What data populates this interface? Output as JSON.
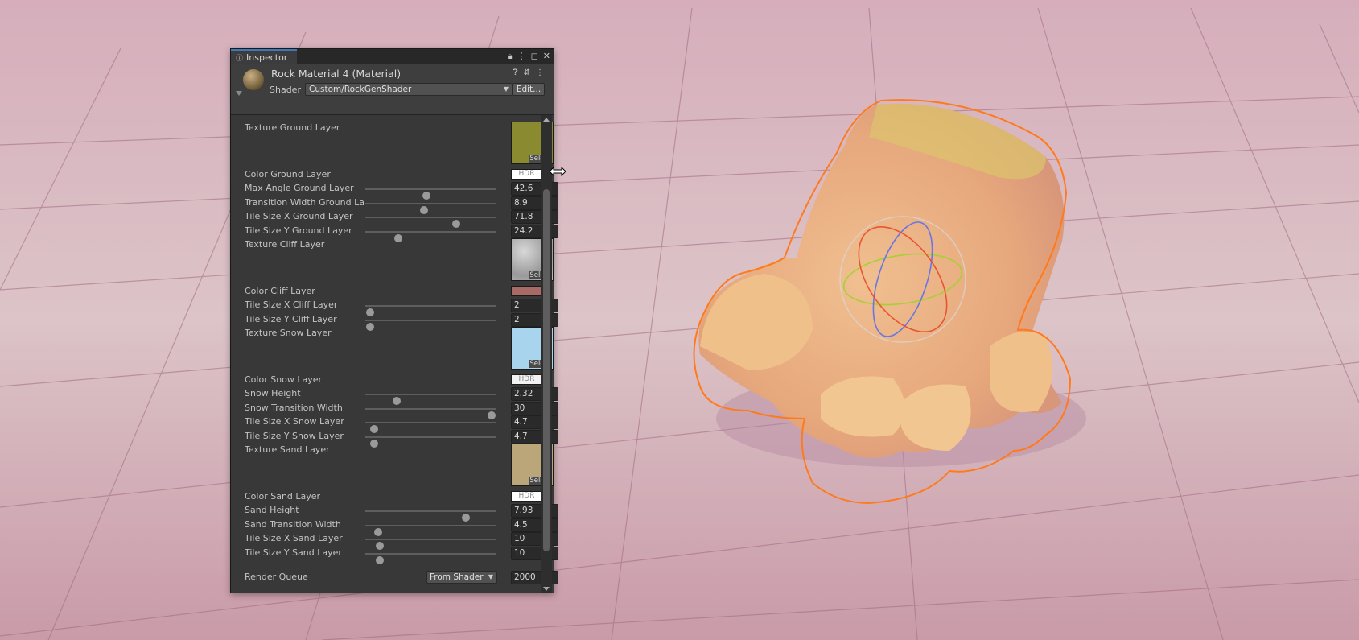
{
  "inspector": {
    "tab_label": "Inspector",
    "tab_icon": "info-icon",
    "window_controls": [
      "lock-icon",
      "kebab-menu-icon",
      "maximize-icon",
      "close-icon"
    ],
    "material_name": "Rock Material 4 (Material)",
    "header_icons": [
      "help-icon",
      "preset-icon",
      "kebab-menu-icon"
    ],
    "shader_label": "Shader",
    "shader_value": "Custom/RockGenShader",
    "edit_label": "Edit...",
    "properties": {
      "texture_ground": {
        "label": "Texture Ground Layer",
        "select": "Select",
        "color": "#8a8a30"
      },
      "color_ground": {
        "label": "Color Ground Layer",
        "swatch_text": "HDR",
        "color": "#ffffff"
      },
      "max_angle_ground": {
        "label": "Max Angle Ground Layer",
        "value": "42.6",
        "fraction": 0.47
      },
      "transition_width_ground": {
        "label": "Transition Width Ground Laye",
        "value": "8.9",
        "fraction": 0.45
      },
      "tile_x_ground": {
        "label": "Tile Size X Ground Layer",
        "value": "71.8",
        "fraction": 0.7
      },
      "tile_y_ground": {
        "label": "Tile Size Y Ground Layer",
        "value": "24.2",
        "fraction": 0.25
      },
      "texture_cliff": {
        "label": "Texture Cliff Layer",
        "select": "Select",
        "color": "#b0b0b0"
      },
      "color_cliff": {
        "label": "Color Cliff Layer",
        "swatch_text": "",
        "color": "#a86a64"
      },
      "tile_x_cliff": {
        "label": "Tile Size X Cliff Layer",
        "value": "2",
        "fraction": 0.04
      },
      "tile_y_cliff": {
        "label": "Tile Size Y Cliff Layer",
        "value": "2",
        "fraction": 0.04
      },
      "texture_snow": {
        "label": "Texture Snow Layer",
        "select": "Select",
        "color": "#a8d4ee"
      },
      "color_snow": {
        "label": "Color Snow Layer",
        "swatch_text": "HDR",
        "color": "#f2f2f2"
      },
      "snow_height": {
        "label": "Snow Height",
        "value": "2.32",
        "fraction": 0.24
      },
      "snow_transition_width": {
        "label": "Snow Transition Width",
        "value": "30",
        "fraction": 0.97
      },
      "tile_x_snow": {
        "label": "Tile Size X Snow Layer",
        "value": "4.7",
        "fraction": 0.07
      },
      "tile_y_snow": {
        "label": "Tile Size Y Snow Layer",
        "value": "4.7",
        "fraction": 0.07
      },
      "texture_sand": {
        "label": "Texture Sand Layer",
        "select": "Select",
        "color": "#bba679"
      },
      "color_sand": {
        "label": "Color Sand Layer",
        "swatch_text": "HDR",
        "color": "#ffffff"
      },
      "sand_height": {
        "label": "Sand Height",
        "value": "7.93",
        "fraction": 0.77
      },
      "sand_transition_width": {
        "label": "Sand Transition Width",
        "value": "4.5",
        "fraction": 0.1
      },
      "tile_x_sand": {
        "label": "Tile Size X Sand Layer",
        "value": "10",
        "fraction": 0.11
      },
      "tile_y_sand": {
        "label": "Tile Size Y Sand Layer",
        "value": "10",
        "fraction": 0.11
      },
      "render_queue": {
        "label": "Render Queue",
        "mode": "From Shader",
        "value": "2000"
      }
    }
  },
  "scene": {
    "outline_color": "#ff7a1a",
    "rock_color": "#e9b78a"
  }
}
